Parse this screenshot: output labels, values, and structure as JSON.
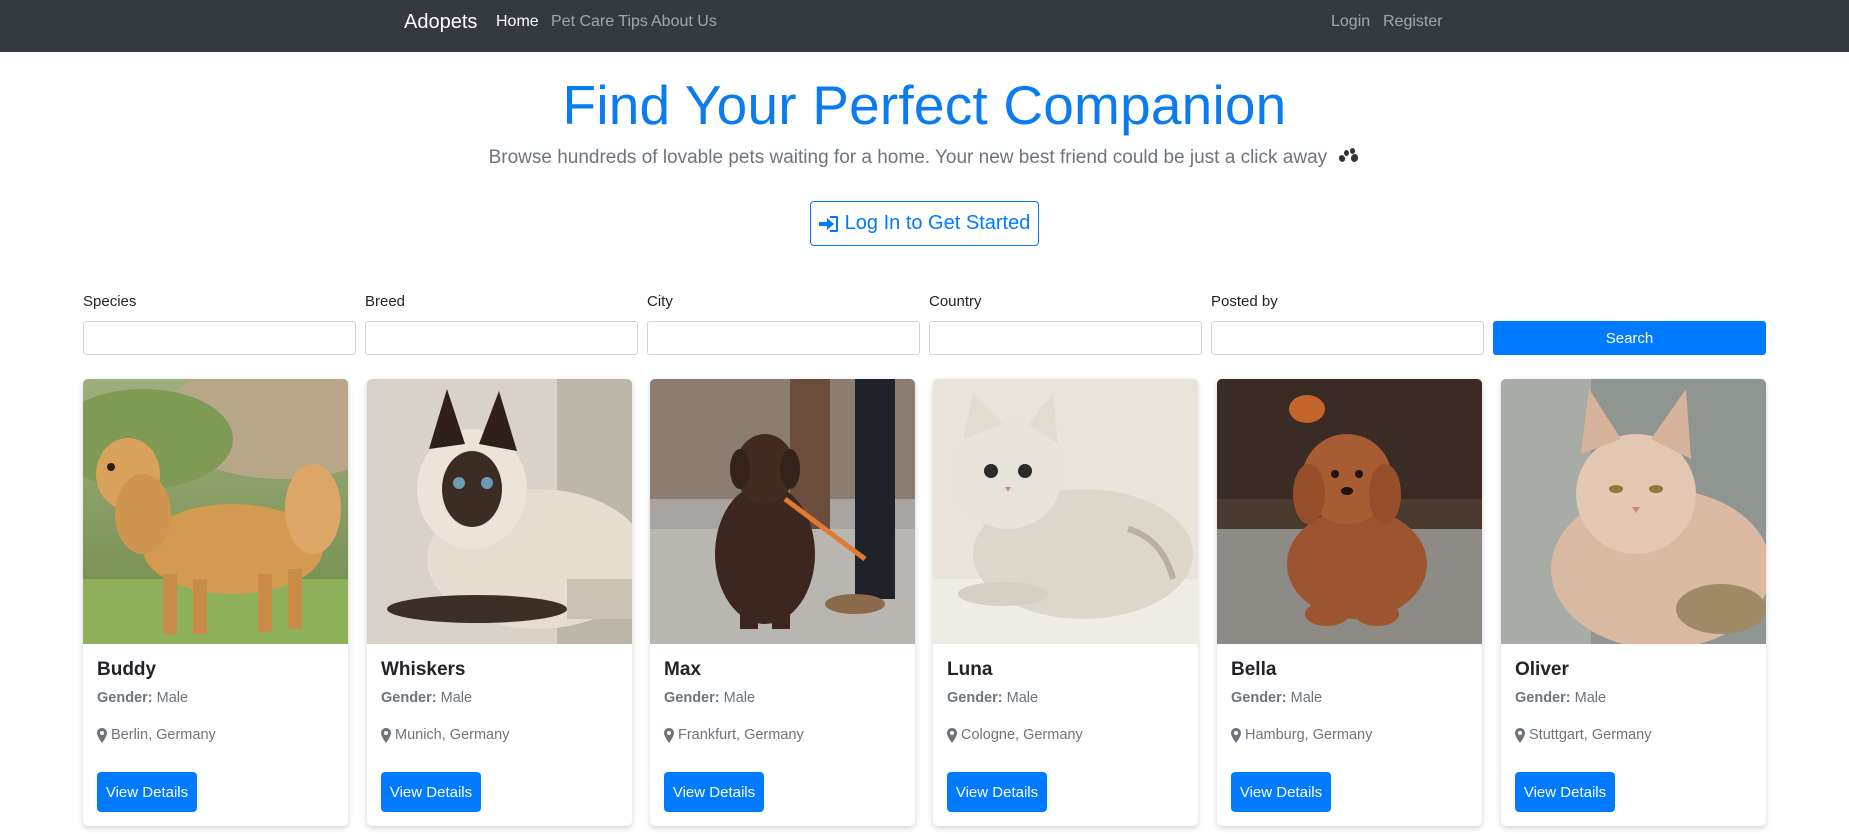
{
  "nav": {
    "brand": "Adopets",
    "links": [
      "Home",
      "Pet Care Tips",
      "About Us"
    ],
    "auth": [
      "Login",
      "Register"
    ]
  },
  "hero": {
    "title": "Find Your Perfect Companion",
    "subtitle": "Browse hundreds of lovable pets waiting for a home. Your new best friend could be just a click away",
    "login_button": "Log In to Get Started",
    "icons": [
      "paw-icon",
      "sign-in-icon"
    ]
  },
  "filters": {
    "labels": [
      "Species",
      "Breed",
      "City",
      "Country",
      "Posted by"
    ],
    "values": [
      "",
      "",
      "",
      "",
      ""
    ],
    "search_button": "Search"
  },
  "pets": [
    {
      "name": "Buddy",
      "gender_label": "Gender:",
      "gender": "Male",
      "location": "Berlin, Germany",
      "button": "View Details",
      "photo": "golden-retriever"
    },
    {
      "name": "Whiskers",
      "gender_label": "Gender:",
      "gender": "Male",
      "location": "Munich, Germany",
      "button": "View Details",
      "photo": "siamese-cat"
    },
    {
      "name": "Max",
      "gender_label": "Gender:",
      "gender": "Male",
      "location": "Frankfurt, Germany",
      "button": "View Details",
      "photo": "chocolate-labrador"
    },
    {
      "name": "Luna",
      "gender_label": "Gender:",
      "gender": "Male",
      "location": "Cologne, Germany",
      "button": "View Details",
      "photo": "white-cat"
    },
    {
      "name": "Bella",
      "gender_label": "Gender:",
      "gender": "Male",
      "location": "Hamburg, Germany",
      "button": "View Details",
      "photo": "poodle"
    },
    {
      "name": "Oliver",
      "gender_label": "Gender:",
      "gender": "Male",
      "location": "Stuttgart, Germany",
      "button": "View Details",
      "photo": "maine-coon"
    }
  ],
  "colors": {
    "navbar": "#343a40",
    "primary": "#007bff",
    "hero_title": "#0a7cf0",
    "muted": "#6c757d"
  }
}
